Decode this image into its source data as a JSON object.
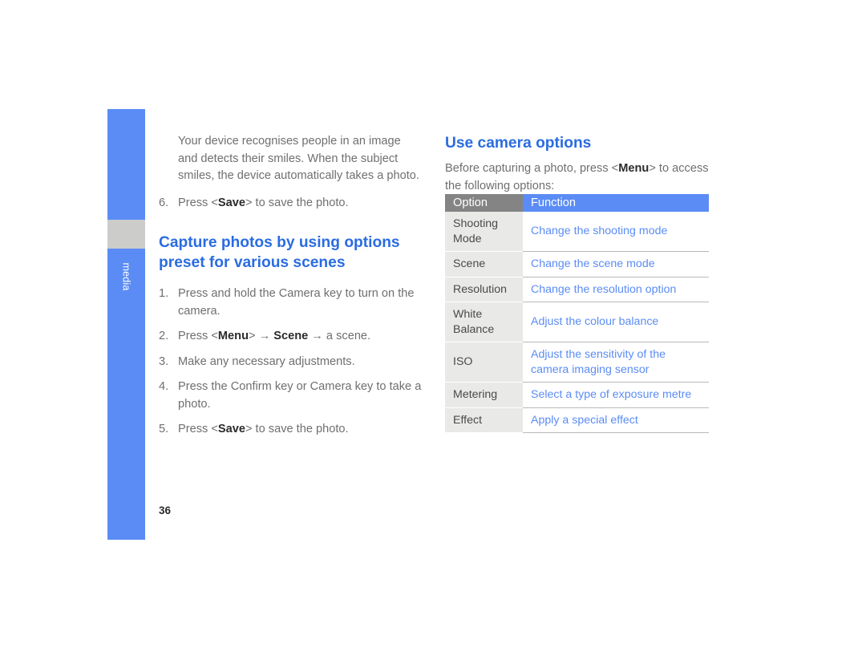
{
  "sidebar": {
    "label": "media",
    "color": "#5b8cf5",
    "marker_color": "#ccccca"
  },
  "page": {
    "number": "36",
    "accent_blue": "#2a6ce0",
    "link_blue": "#5b8cf5",
    "body_gray": "#6f6f6f"
  },
  "left_column": {
    "intro_paragraph": "Your device recognises people in an image and detects their smiles. When the subject smiles, the device automatically takes a photo.",
    "step6": {
      "number": "6.",
      "pre": "Press <",
      "bold": "Save",
      "post": "> to save the photo."
    },
    "heading": "Capture photos by using options preset for various scenes",
    "steps": [
      {
        "number": "1.",
        "text": "Press and hold the Camera key to turn on the camera."
      },
      {
        "number": "2.",
        "pre": "Press <",
        "bold1": "Menu",
        "mid1": "> → ",
        "bold2": "Scene",
        "post": " → a scene."
      },
      {
        "number": "3.",
        "text": "Make any necessary adjustments."
      },
      {
        "number": "4.",
        "text": "Press the Confirm key or Camera key to take a photo."
      },
      {
        "number": "5.",
        "pre": "Press <",
        "bold": "Save",
        "post": "> to save the photo."
      }
    ]
  },
  "right_column": {
    "heading": "Use camera options",
    "intro": {
      "pre": "Before capturing a photo, press <",
      "bold": "Menu",
      "post": "> to access the following options:"
    },
    "table": {
      "headers": [
        "Option",
        "Function"
      ],
      "rows": [
        {
          "option": "Shooting\nMode",
          "function": "Change the shooting mode",
          "tall": true
        },
        {
          "option": "Scene",
          "function": "Change the scene mode",
          "tall": false
        },
        {
          "option": "Resolution",
          "function": "Change the resolution option",
          "tall": false
        },
        {
          "option": "White\nBalance",
          "function": "Adjust the colour balance",
          "tall": true
        },
        {
          "option": "ISO",
          "function": "Adjust the sensitivity of the\ncamera imaging sensor",
          "tall": true
        },
        {
          "option": "Metering",
          "function": "Select a type of exposure metre",
          "tall": false
        },
        {
          "option": "Effect",
          "function": "Apply a special effect",
          "tall": false
        }
      ]
    }
  }
}
